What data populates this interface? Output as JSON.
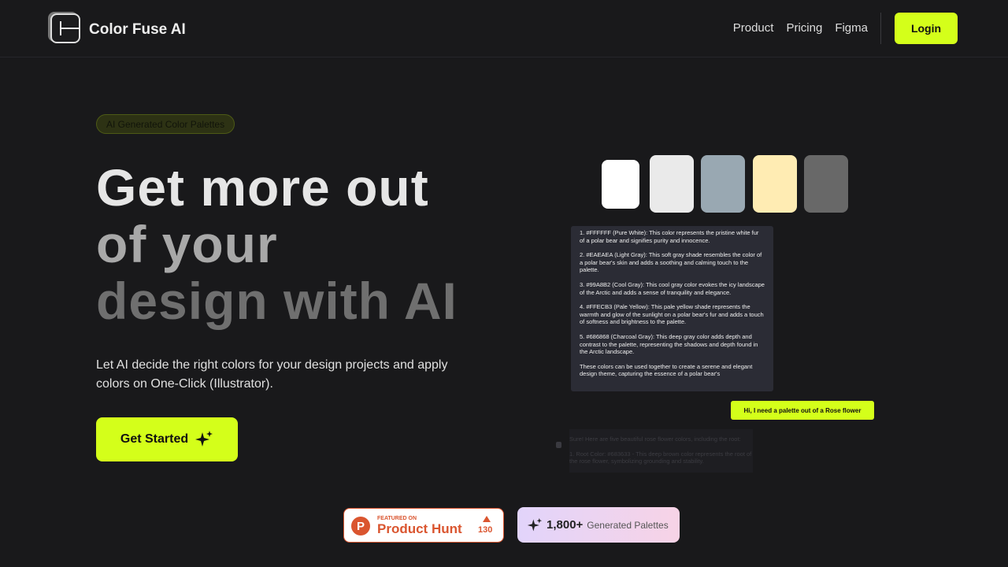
{
  "nav": {
    "brand": "Color Fuse AI",
    "links": [
      "Product",
      "Pricing",
      "Figma"
    ],
    "login": "Login"
  },
  "hero": {
    "badge": "AI Generated Color Palettes",
    "title_lines": [
      "Get more out",
      "of your",
      "design with AI"
    ],
    "subtitle": "Let AI decide the right colors for your design projects and apply colors on One-Click (Illustrator).",
    "cta": "Get Started"
  },
  "palette": {
    "colors": [
      "#FFFFFF",
      "#EAEAEA",
      "#99A8B2",
      "#FFECB3",
      "#686868"
    ]
  },
  "chat": {
    "response": [
      "1. #FFFFFF (Pure White): This color represents the pristine white fur of a polar bear and signifies purity and innocence.",
      "2. #EAEAEA (Light Gray): This soft gray shade resembles the color of a polar bear's skin and adds a soothing and calming touch to the palette.",
      "3. #99A8B2 (Cool Gray): This cool gray color evokes the icy landscape of the Arctic and adds a sense of tranquility and elegance.",
      "4. #FFECB3 (Pale Yellow): This pale yellow shade represents the warmth and glow of the sunlight on a polar bear's fur and adds a touch of softness and brightness to the palette.",
      "5. #686868 (Charcoal Gray): This deep gray color adds depth and contrast to the palette, representing the shadows and depth found in the Arctic landscape.",
      "These colors can be used together to create a serene and elegant design theme, capturing the essence of a polar bear's"
    ],
    "user_message": "Hi, I need a palette out of a Rose flower",
    "next_response": [
      "Sure! Here are five beautiful rose flower colors, including the root:",
      "1. Root Color: #683633 - This deep brown color represents the root of the rose flower, symbolizing grounding and stability."
    ]
  },
  "badges": {
    "ph_featured": "FEATURED ON",
    "ph_name": "Product Hunt",
    "ph_votes": "130",
    "ph_logo": "P",
    "count": "1,800+",
    "count_label": "Generated Palettes"
  },
  "colors": {
    "accent": "#D4FF1A",
    "background": "#19191B",
    "product_hunt": "#DA552F"
  }
}
